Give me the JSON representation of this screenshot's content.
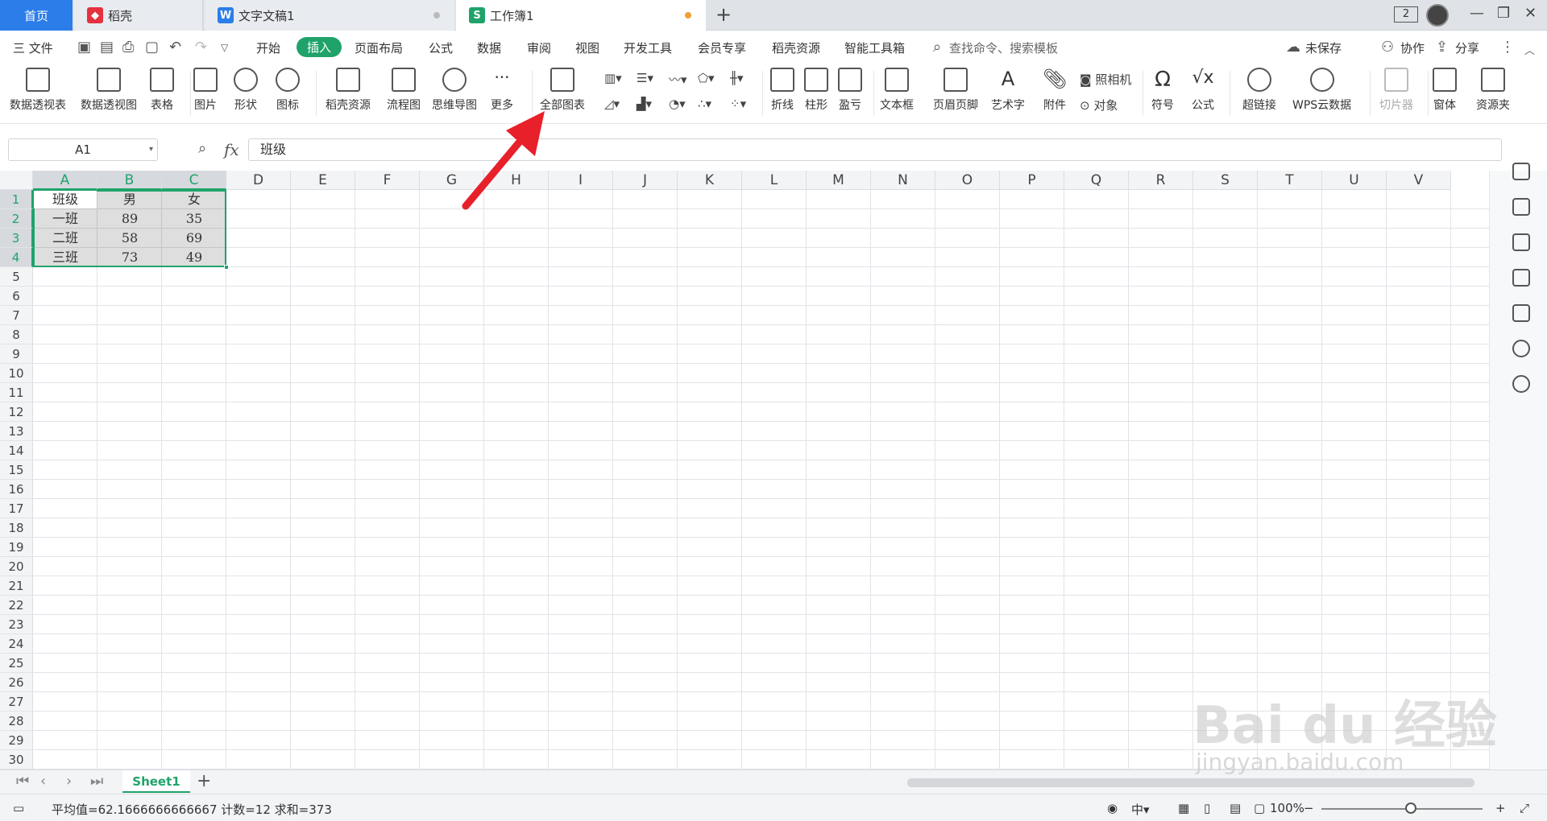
{
  "tabs": {
    "home": "首页",
    "daoke": "稻壳",
    "doc": "文字文稿1",
    "workbook": "工作簿1",
    "add": "+"
  },
  "window": {
    "badge": "2"
  },
  "menu": {
    "file": "三 文件",
    "items": [
      "开始",
      "插入",
      "页面布局",
      "公式",
      "数据",
      "审阅",
      "视图",
      "开发工具",
      "会员专享",
      "稻壳资源",
      "智能工具箱"
    ],
    "active": "插入",
    "search": "查找命令、搜索模板",
    "unsaved": "未保存",
    "collab": "协作",
    "share": "分享"
  },
  "ribbon": {
    "pivot_table": "数据透视表",
    "pivot_view": "数据透视图",
    "table": "表格",
    "picture": "图片",
    "shape": "形状",
    "icon": "图标",
    "daoke_res": "稻壳资源",
    "flowchart": "流程图",
    "mindmap": "思维导图",
    "more": "更多",
    "all_charts": "全部图表",
    "line": "折线",
    "column": "柱形",
    "winloss": "盈亏",
    "textbox": "文本框",
    "header_footer": "页眉页脚",
    "wordart": "艺术字",
    "attachment": "附件",
    "camera": "照相机",
    "object": "对象",
    "symbol": "符号",
    "formula": "公式",
    "hyperlink": "超链接",
    "wps_cloud": "WPS云数据",
    "slicer": "切片器",
    "window": "窗体",
    "resource": "资源夹"
  },
  "formula_bar": {
    "name_box": "A1",
    "fx": "fx",
    "content": "班级"
  },
  "grid": {
    "columns": [
      "A",
      "B",
      "C",
      "D",
      "E",
      "F",
      "G",
      "H",
      "I",
      "J",
      "K",
      "L",
      "M",
      "N",
      "O",
      "P",
      "Q",
      "R",
      "S",
      "T",
      "U",
      "V"
    ],
    "rows": [
      "1",
      "2",
      "3",
      "4",
      "5",
      "6",
      "7",
      "8",
      "9",
      "10",
      "11",
      "12",
      "13",
      "14",
      "15",
      "16",
      "17",
      "18",
      "19",
      "20",
      "21",
      "22",
      "23",
      "24",
      "25",
      "26",
      "27",
      "28",
      "29",
      "30"
    ],
    "cells": [
      [
        "班级",
        "男",
        "女"
      ],
      [
        "一班",
        "89",
        "35"
      ],
      [
        "二班",
        "58",
        "69"
      ],
      [
        "三班",
        "73",
        "49"
      ]
    ]
  },
  "sheets": {
    "active": "Sheet1",
    "add": "+"
  },
  "status": {
    "summary": "平均值=62.1666666666667  计数=12  求和=373",
    "zoom": "100%"
  },
  "colors": {
    "accent": "#1fa36b",
    "home_tab": "#2b7de9",
    "arrow": "#e8202a"
  },
  "watermark": {
    "main": "Bai du 经验",
    "sub": "jingyan.baidu.com"
  }
}
